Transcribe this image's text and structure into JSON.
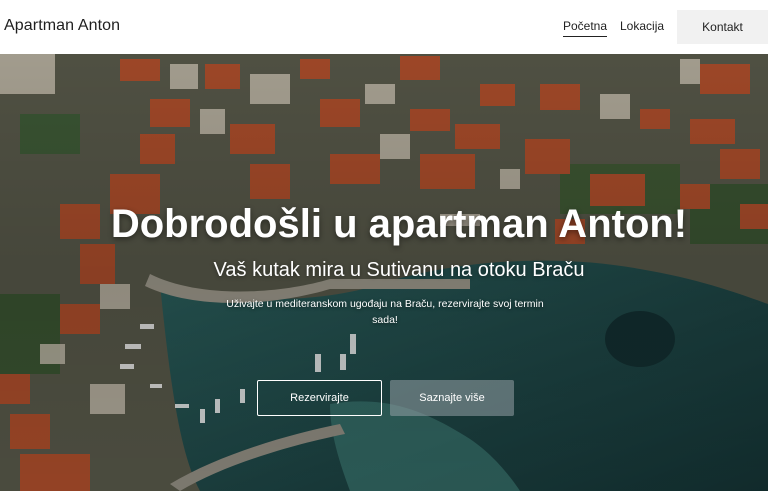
{
  "header": {
    "brand": "Apartman Anton",
    "nav": {
      "home": "Početna",
      "location": "Lokacija",
      "contact": "Kontakt"
    }
  },
  "hero": {
    "title": "Dobrodošli u apartman Anton!",
    "subtitle": "Vaš kutak mira u Sutivanu na otoku Braču",
    "text": "Uživajte u mediteranskom ugođaju na Braču, rezervirajte svoj termin sada!",
    "reserve_label": "Rezervirajte",
    "more_label": "Saznajte više"
  },
  "colors": {
    "roof": "#b8532e",
    "sea_deep": "#1f4a4a",
    "sea_shallow": "#3f7f78",
    "greenery": "#3e5a35"
  }
}
